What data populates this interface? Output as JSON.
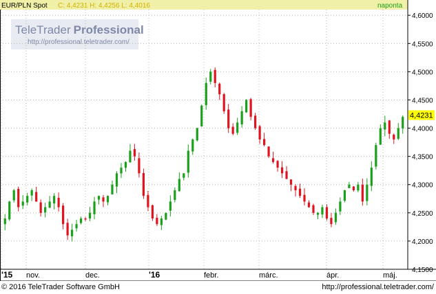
{
  "header": {
    "symbol": "EUR/PLN Spot",
    "ohlc": "C: 4,4231 H: 4,4256 L: 4,4016",
    "period": "naponta"
  },
  "watermark": {
    "brand_main": "TeleTrader",
    "brand_bold": "Professional",
    "url": "http://professional.teletrader.com/"
  },
  "footer": {
    "copyright": "© 2016 TeleTrader Software GmbH",
    "url": "http://professional.teletrader.com/"
  },
  "last_price_label": "4,4231",
  "colors": {
    "up": "#1aa01a",
    "down": "#e0141e",
    "header_bg": "#f0f0a8",
    "grid": "#b4b4b4",
    "last_price_bg": "#ffff00"
  },
  "chart_data": {
    "type": "candlestick",
    "title": "EUR/PLN Spot",
    "y_tick_labels": [
      "4,6000",
      "4,5500",
      "4,5000",
      "4,4500",
      "4,4000",
      "4,3500",
      "4,3000",
      "4,2500",
      "4,2000",
      "4,1500"
    ],
    "ylim": [
      4.15,
      4.61
    ],
    "x_tick_labels": [
      "'15",
      "nov.",
      "dec.",
      "'16",
      "febr.",
      "márc.",
      "ápr.",
      "máj."
    ],
    "x_tick_bold": [
      "'15",
      "'16"
    ],
    "grid": true,
    "approx_daily_close": [
      4.24,
      4.27,
      4.29,
      4.26,
      4.27,
      4.28,
      4.29,
      4.27,
      4.25,
      4.26,
      4.27,
      4.28,
      4.26,
      4.23,
      4.21,
      4.22,
      4.23,
      4.24,
      4.24,
      4.25,
      4.27,
      4.28,
      4.27,
      4.28,
      4.3,
      4.32,
      4.33,
      4.34,
      4.36,
      4.35,
      4.32,
      4.28,
      4.26,
      4.24,
      4.23,
      4.24,
      4.25,
      4.27,
      4.29,
      4.31,
      4.32,
      4.36,
      4.38,
      4.4,
      4.44,
      4.48,
      4.5,
      4.48,
      4.46,
      4.43,
      4.4,
      4.39,
      4.41,
      4.43,
      4.45,
      4.42,
      4.4,
      4.38,
      4.37,
      4.35,
      4.34,
      4.33,
      4.32,
      4.31,
      4.3,
      4.29,
      4.28,
      4.27,
      4.26,
      4.25,
      4.25,
      4.26,
      4.24,
      4.23,
      4.25,
      4.27,
      4.29,
      4.3,
      4.29,
      4.3,
      4.27,
      4.3,
      4.33,
      4.37,
      4.4,
      4.41,
      4.39,
      4.38,
      4.4,
      4.42
    ]
  }
}
